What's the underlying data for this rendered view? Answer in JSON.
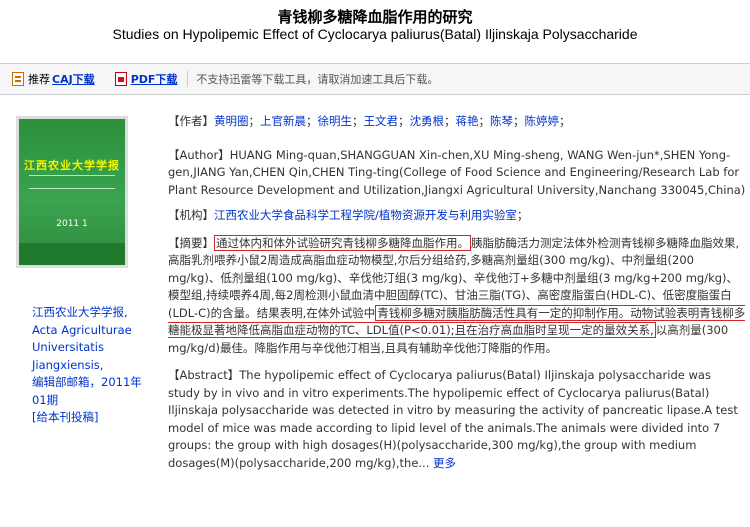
{
  "title": {
    "zh": "青钱柳多糖降血脂作用的研究",
    "en": "Studies on Hypolipemic Effect of Cyclocarya paliurus(Batal) Iljinskaja Polysaccharide"
  },
  "toolbar": {
    "recommend_prefix": "推荐",
    "caj_label": "CAJ下载",
    "pdf_label": "PDF下载",
    "note": "不支持迅雷等下载工具，请取消加速工具后下载。"
  },
  "cover": {
    "title": "江西农业大学学报",
    "year": "2011 1"
  },
  "journal": {
    "name_zh": "江西农业大学学报",
    "name_en_1": "Acta Agriculturae",
    "name_en_2": "Universitatis",
    "name_en_3": "Jiangxiensis",
    "suffix": "编辑部邮箱，2011年",
    "issue": "01期",
    "print_link": "[给本刊投稿]"
  },
  "authors": {
    "label": "【作者】",
    "names": [
      "黄明圈",
      "上官新晨",
      "徐明生",
      "王文君",
      "沈勇根",
      "蒋艳",
      "陈琴",
      "陈婷婷"
    ]
  },
  "author_en": {
    "label": "【Author】",
    "text": "HUANG Ming-quan,SHANGGUAN Xin-chen,XU Ming-sheng, WANG Wen-jun*,SHEN Yong-gen,JIANG Yan,CHEN Qin,CHEN Ting-ting(College of Food Science and Engineering/Research Lab for Plant Resource Development and Utilization,Jiangxi Agricultural University,Nanchang 330045,China)"
  },
  "institution": {
    "label": "【机构】",
    "text": "江西农业大学食品科学工程学院/植物资源开发与利用实验室"
  },
  "abstract_zh": {
    "label": "【摘要】",
    "box1": "通过体内和体外试验研究青钱柳多糖降血脂作用。",
    "part2": "胰脂肪酶活力测定法体外检测青钱柳多糖降血脂效果,高脂乳剂喂养小鼠2周造成高脂血症动物模型,尔后分组给药,多糖高剂量组(300 mg/kg)、中剂量组(200 mg/kg)、低剂量组(100 mg/kg)、辛伐他汀组(3 mg/kg)、辛伐他汀+多糖中剂量组(3 mg/kg+200 mg/kg)、模型组,持续喂养4周,每2周检测小鼠血清中胆固醇(TC)、甘油三脂(TG)、高密度脂蛋白(HDL-C)、低密度脂蛋白(LDL-C)的含量。结果表明,在体外试验中",
    "box2": "青钱柳多糖对胰脂肪酶活性具有一定的抑制作用。动物试验表明青钱柳多糖能极显著地降低高脂血症动物的TC、LDL值(P<0.01);且在治疗高血脂时呈现一定的量效关系,",
    "part3": "以高剂量(300 mg/kg/d)最佳。降脂作用与辛伐他汀相当,且具有辅助辛伐他汀降脂的作用。"
  },
  "abstract_en": {
    "label": "【Abstract】",
    "text": "The hypolipemic effect of Cyclocarya paliurus(Batal) Iljinskaja polysaccharide was study by in vivo and in vitro experiments.The hypolipemic effect of Cyclocarya paliurus(Batal) Iljinskaja polysaccharide was detected in vitro by measuring the activity of pancreatic lipase.A test model of mice was made according to lipid level of the animals.The animals were divided into 7 groups: the group with high dosages(H)(polysaccharide,300 mg/kg),the group with medium dosages(M)(polysaccharide,200 mg/kg),the...",
    "more": "更多"
  }
}
